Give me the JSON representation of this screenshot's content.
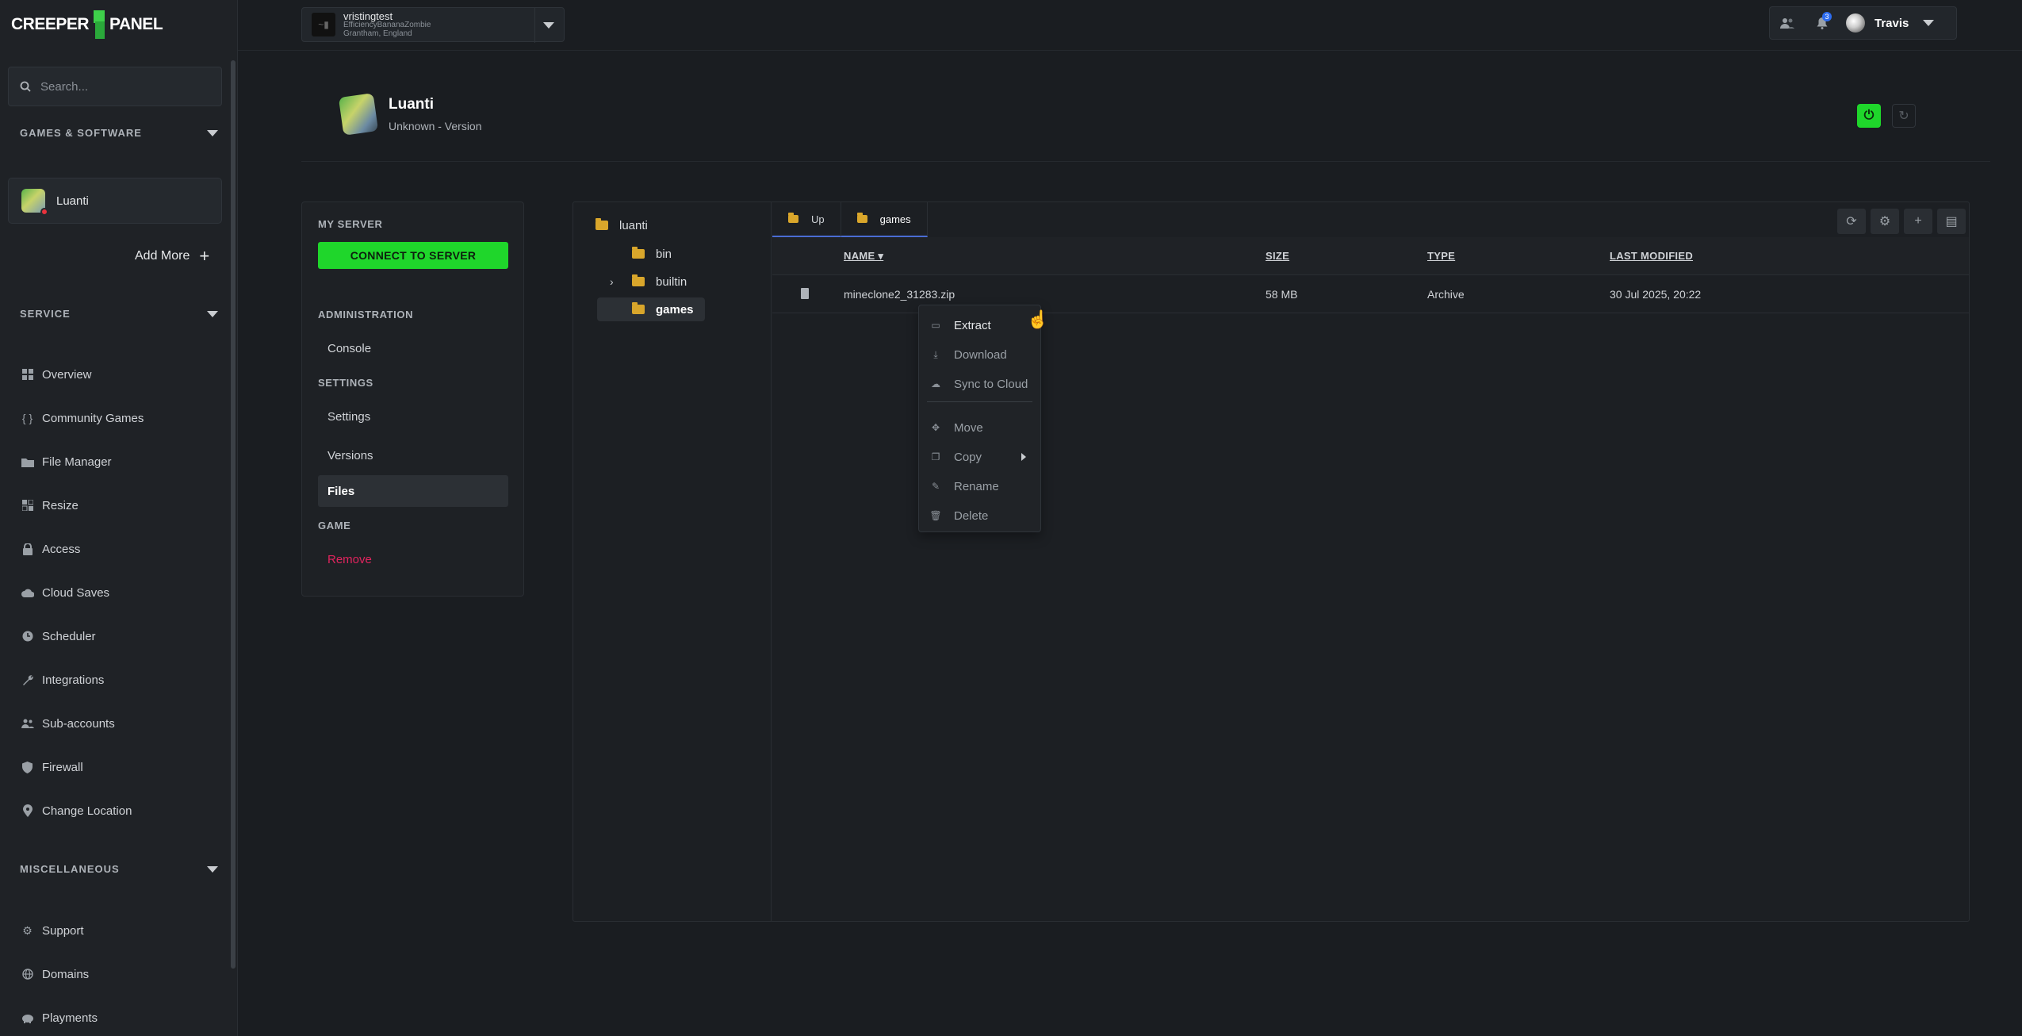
{
  "app": {
    "brand_left": "CREEPER",
    "brand_right": "PANEL"
  },
  "sidebar": {
    "search_placeholder": "Search...",
    "games_heading": "GAMES & SOFTWARE",
    "game_name": "Luanti",
    "add_more": "Add More",
    "service_heading": "SERVICE",
    "items": [
      {
        "label": "Overview",
        "icon": "grid-icon"
      },
      {
        "label": "Community Games",
        "icon": "braces-icon"
      },
      {
        "label": "File Manager",
        "icon": "folder-icon"
      },
      {
        "label": "Resize",
        "icon": "resize-icon"
      },
      {
        "label": "Access",
        "icon": "lock-icon"
      },
      {
        "label": "Cloud Saves",
        "icon": "cloud-icon"
      },
      {
        "label": "Scheduler",
        "icon": "clock-icon"
      },
      {
        "label": "Integrations",
        "icon": "wrench-icon"
      },
      {
        "label": "Sub-accounts",
        "icon": "users-icon"
      },
      {
        "label": "Firewall",
        "icon": "shield-icon"
      },
      {
        "label": "Change Location",
        "icon": "pin-icon"
      }
    ],
    "misc_heading": "MISCELLANEOUS",
    "misc_items": [
      {
        "label": "Support",
        "icon": "gear-icon"
      },
      {
        "label": "Domains",
        "icon": "globe-icon"
      },
      {
        "label": "Playments",
        "icon": "piggy-bank-icon"
      }
    ]
  },
  "topbar": {
    "server_name": "vristingtest",
    "server_sub1": "EfficiencyBananaZombie",
    "server_sub2": "Grantham, England",
    "notif_count": "3",
    "user_name": "Travis"
  },
  "server": {
    "title": "Luanti",
    "version": "Unknown - Version"
  },
  "menu": {
    "my_server": "MY SERVER",
    "connect": "CONNECT TO SERVER",
    "administration": "ADMINISTRATION",
    "console": "Console",
    "settings_head": "SETTINGS",
    "settings": "Settings",
    "versions": "Versions",
    "files": "Files",
    "game_head": "GAME",
    "remove": "Remove"
  },
  "filemanager": {
    "tree": {
      "root": "luanti",
      "bin": "bin",
      "builtin": "builtin",
      "games": "games"
    },
    "tabs": {
      "up": "Up",
      "current": "games"
    },
    "columns": {
      "name": "NAME",
      "size": "SIZE",
      "type": "TYPE",
      "modified": "LAST MODIFIED"
    },
    "files": [
      {
        "name": "mineclone2_31283.zip",
        "size": "58 MB",
        "type": "Archive",
        "modified": "30 Jul 2025, 20:22"
      }
    ]
  },
  "context_menu": {
    "extract": "Extract",
    "download": "Download",
    "sync": "Sync to Cloud",
    "move": "Move",
    "copy": "Copy",
    "rename": "Rename",
    "delete": "Delete"
  },
  "colors": {
    "accent_green": "#1fd62b",
    "danger": "#e0245e",
    "folder": "#d9a62b",
    "tab_underline": "#4a6cd4"
  }
}
